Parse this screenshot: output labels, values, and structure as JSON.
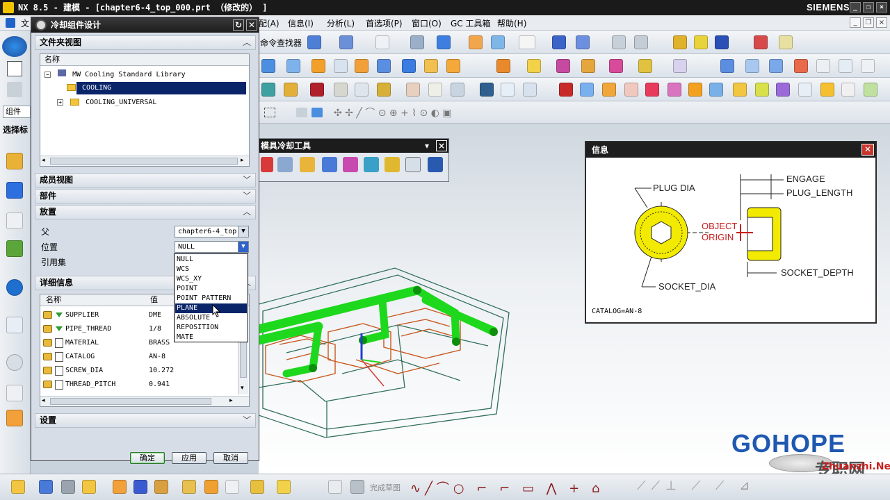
{
  "window": {
    "title": "NX 8.5 - 建模 - [chapter6-4_top_000.prt （修改的） ]",
    "brand": "SIEMENS"
  },
  "menubar": {
    "items": [
      "文",
      "配(A)",
      "信息(I)",
      "分析(L)",
      "首选项(P)",
      "窗口(O)",
      "GC 工具箱",
      "帮助(H)"
    ],
    "command_finder": "命令查找器"
  },
  "left_labels": {
    "component": "组件",
    "select": "选择标"
  },
  "dialog": {
    "title": "冷却组件设计",
    "folder_view": {
      "section_label": "文件夹视图",
      "column_name": "名称",
      "tree": [
        {
          "label": "MW Cooling Standard Library",
          "selected": false
        },
        {
          "label": "COOLING",
          "selected": true
        },
        {
          "label": "COOLING_UNIVERSAL",
          "selected": false
        }
      ]
    },
    "member_view_label": "成员视图",
    "part_label": "部件",
    "placement": {
      "section_label": "放置",
      "parent_label": "父",
      "parent_value": "chapter6-4_top",
      "position_label": "位置",
      "position_value": "NULL",
      "refset_label": "引用集"
    },
    "position_options": [
      "NULL",
      "WCS",
      "WCS_XY",
      "POINT",
      "POINT PATTERN",
      "PLANE",
      "ABSOLUTE",
      "REPOSITION",
      "MATE"
    ],
    "position_highlighted": "PLANE",
    "details": {
      "section_label": "详细信息",
      "col_name": "名称",
      "col_value": "值",
      "rows": [
        {
          "name": "SUPPLIER",
          "value": "DME",
          "kind": "option"
        },
        {
          "name": "PIPE_THREAD",
          "value": "1/8",
          "kind": "option"
        },
        {
          "name": "MATERIAL",
          "value": "BRASS",
          "kind": "param"
        },
        {
          "name": "CATALOG",
          "value": "AN-8",
          "kind": "param"
        },
        {
          "name": "SCREW_DIA",
          "value": "10.272",
          "kind": "param"
        },
        {
          "name": "THREAD_PITCH",
          "value": "0.941",
          "kind": "param"
        }
      ]
    },
    "settings_label": "设置",
    "buttons": {
      "ok": "确定",
      "apply": "应用",
      "cancel": "取消"
    }
  },
  "cooling_toolbar": {
    "title": "模具冷却工具"
  },
  "info_window": {
    "title": "信息",
    "labels": {
      "plug_dia": "PLUG DIA",
      "engage": "ENGAGE",
      "plug_length": "PLUG_LENGTH",
      "object": "OBJECT",
      "origin": "ORIGIN",
      "socket_dia": "SOCKET_DIA",
      "socket_depth": "SOCKET_DEPTH",
      "catalog": "CATALOG=AN-8"
    },
    "colors": {
      "part_fill": "#f2ea00",
      "origin_marker": "#c81e1e"
    }
  },
  "bottom_toolbar": {
    "finish_sketch": "完成草图"
  },
  "watermark": {
    "gohope": "GOHOPE",
    "site": "Zhuanzhi.Net",
    "cn": "专职网"
  },
  "colors": {
    "pipes": "#1ed81e",
    "mold_edges": "#2f6f5a",
    "inserts": "#c8581e",
    "selection": "#0a246a"
  }
}
